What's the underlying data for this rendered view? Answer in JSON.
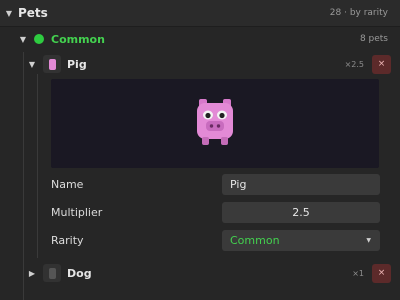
{
  "header": {
    "title": "Pets",
    "meta": "28 · by rarity"
  },
  "group": {
    "label": "Common",
    "count": "8 pets"
  },
  "pets": [
    {
      "name": "Pig",
      "count": "×2.5",
      "close_label": "×",
      "expanded": true
    },
    {
      "name": "Dog",
      "count": "×1",
      "close_label": "×",
      "expanded": false
    }
  ],
  "detail": {
    "name_label": "Name",
    "name_value": "Pig",
    "multiplier_label": "Multiplier",
    "multiplier_value": "2.5",
    "rarity_label": "Rarity",
    "rarity_value": "Common"
  },
  "icons": {
    "expanded": "caret-down",
    "collapsed": "caret-right",
    "status": "green-dot"
  },
  "colors": {
    "rarity_common": "#43d14f",
    "pig": "#e38ad6",
    "remove_button": "#5c2a2a"
  }
}
